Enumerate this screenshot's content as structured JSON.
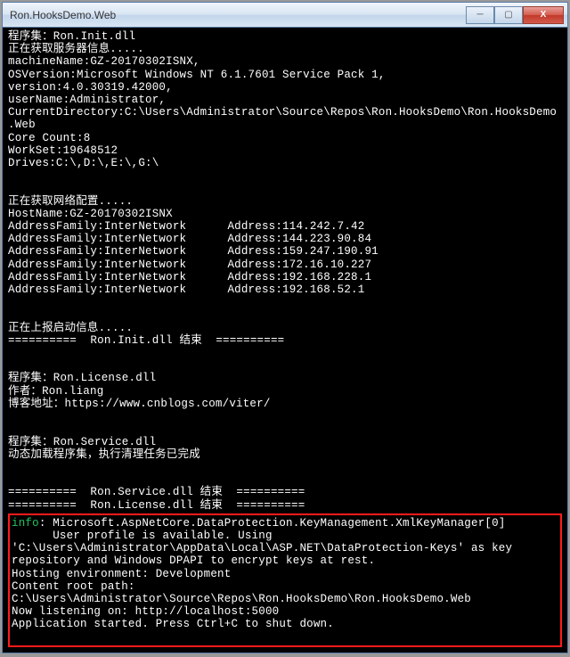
{
  "window": {
    "title": "Ron.HooksDemo.Web"
  },
  "controls": {
    "minimize": "─",
    "maximize": "▢",
    "close": "X"
  },
  "preText": "程序集：Ron.Init.dll\n正在获取服务器信息.....\nmachineName:GZ-20170302ISNX,\nOSVersion:Microsoft Windows NT 6.1.7601 Service Pack 1,\nversion:4.0.30319.42000,\nuserName:Administrator,\nCurrentDirectory:C:\\Users\\Administrator\\Source\\Repos\\Ron.HooksDemo\\Ron.HooksDemo\n.Web\nCore Count:8\nWorkSet:19648512\nDrives:C:\\,D:\\,E:\\,G:\\\n\n\n正在获取网络配置.....\nHostName:GZ-20170302ISNX\nAddressFamily:InterNetwork      Address:114.242.7.42\nAddressFamily:InterNetwork      Address:144.223.90.84\nAddressFamily:InterNetwork      Address:159.247.190.91\nAddressFamily:InterNetwork      Address:172.16.10.227\nAddressFamily:InterNetwork      Address:192.168.228.1\nAddressFamily:InterNetwork      Address:192.168.52.1\n\n\n正在上报启动信息.....\n==========  Ron.Init.dll 结束  ==========\n\n\n程序集：Ron.License.dll\n作者：Ron.liang\n博客地址：https://www.cnblogs.com/viter/\n\n\n程序集：Ron.Service.dll\n动态加载程序集，执行清理任务已完成\n\n\n==========  Ron.Service.dll 结束  ==========\n==========  Ron.License.dll 结束  ==========",
  "infoLabel": "info",
  "infoLine": ": Microsoft.AspNetCore.DataProtection.KeyManagement.XmlKeyManager[0]",
  "postInfo": "      User profile is available. Using 'C:\\Users\\Administrator\\AppData\\Local\\ASP.NET\\DataProtection-Keys' as key repository and Windows DPAPI to encrypt keys at rest.\nHosting environment: Development\nContent root path: C:\\Users\\Administrator\\Source\\Repos\\Ron.HooksDemo\\Ron.HooksDemo.Web\nNow listening on: http://localhost:5000\nApplication started. Press Ctrl+C to shut down."
}
